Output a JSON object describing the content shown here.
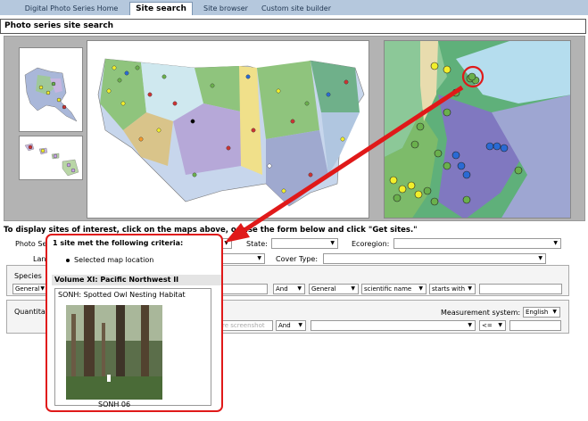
{
  "tabs": [
    {
      "label": "Digital Photo Series Home",
      "active": false
    },
    {
      "label": "Site search",
      "active": true
    },
    {
      "label": "Site browser",
      "active": false
    },
    {
      "label": "Custom site builder",
      "active": false
    }
  ],
  "panel_title": "Photo series site search",
  "instructions": "To display sites of interest, click on the maps above, or use the form below and click \"Get sites.\"",
  "form": {
    "photo_series_label": "Photo Se",
    "state_label": "State:",
    "ecoregion_label": "Ecoregion:",
    "land_label": "Lan",
    "cover_type_label": "Cover Type:",
    "species_label": "Species",
    "species_value": "General",
    "and_label": "And",
    "general_value": "General",
    "scientific_name_value": "scientific name",
    "starts_with_value": "starts with",
    "quantitative_label": "Quantita",
    "measurement_system_label": "Measurement system:",
    "measurement_system_value": "English",
    "screenshot_button": "re screenshot",
    "and2_label": "And",
    "operator_value": "<="
  },
  "popup": {
    "criteria_title": "1 site met the following criteria:",
    "criteria_item": "Selected map location",
    "volume_title": "Volume XI:  Pacific Northwest II",
    "site_title": "SONH: Spotted Owl Nesting Habitat",
    "photo_caption": "SONH 06"
  },
  "colors": {
    "tab_bar": "#b5c8dd",
    "highlight_red": "#e01919",
    "map_background": "#b3b3b3"
  }
}
